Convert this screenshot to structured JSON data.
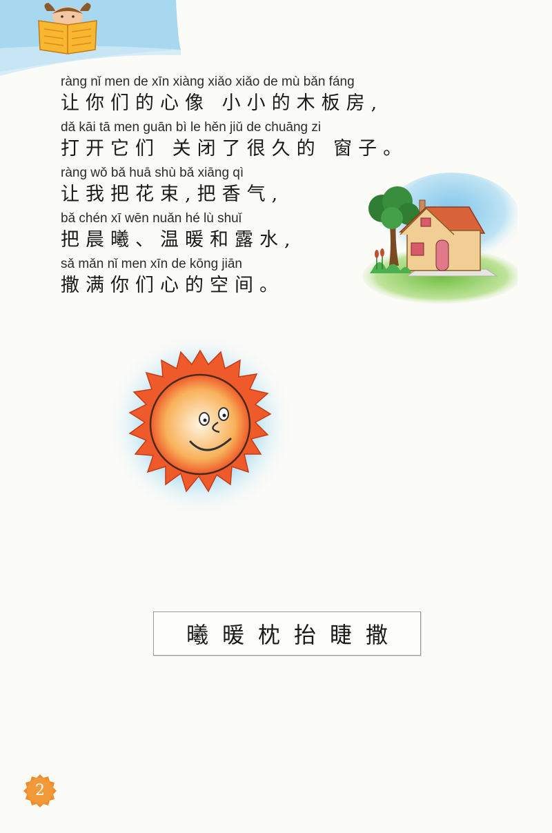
{
  "poem": {
    "lines": [
      {
        "pinyin": "ràng nǐ men de xīn xiàng xiǎo xiǎo de mù bǎn fáng",
        "hanzi": "让你们的心像 小小的木板房,"
      },
      {
        "pinyin": "dǎ kāi tā men guān bì  le hěn jiǔ de chuāng zi",
        "hanzi": "打开它们 关闭了很久的 窗子。"
      },
      {
        "pinyin": "ràng wǒ bǎ huā shù   bǎ xiāng qì",
        "hanzi": "让我把花束,把香气,"
      },
      {
        "pinyin": "bǎ chén xī    wēn nuǎn hé lù shuǐ",
        "hanzi": "把晨曦、温暖和露水,"
      },
      {
        "pinyin": "sǎ mǎn nǐ men xīn de kōng jiān",
        "hanzi": "撒满你们心的空间。"
      }
    ]
  },
  "vocabulary": {
    "words": "曦暖枕抬睫撒"
  },
  "page_number": "2",
  "colors": {
    "banner_blue": "#9fd3ee",
    "sun_orange": "#ef5a2a",
    "badge_orange": "#f08a2a",
    "house_roof": "#d9643a",
    "grass_green": "#7cc24a"
  }
}
